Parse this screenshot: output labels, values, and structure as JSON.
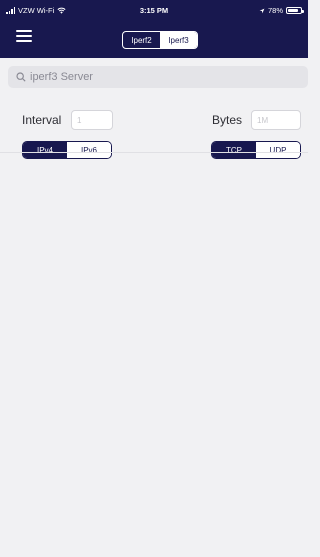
{
  "status_bar": {
    "carrier": "VZW Wi-Fi",
    "time": "3:15 PM",
    "battery": "78%"
  },
  "header": {
    "tabs": [
      {
        "label": "Iperf2",
        "selected": false
      },
      {
        "label": "Iperf3",
        "selected": true
      }
    ]
  },
  "search": {
    "placeholder": "iperf3 Server"
  },
  "options": {
    "interval_label": "Interval",
    "interval_placeholder": "1",
    "bytes_label": "Bytes",
    "bytes_placeholder": "1M",
    "ip_version": [
      {
        "label": "IPv4",
        "selected": true
      },
      {
        "label": "IPv6",
        "selected": false
      }
    ],
    "protocol": [
      {
        "label": "TCP",
        "selected": true
      },
      {
        "label": "UDP",
        "selected": false
      }
    ]
  },
  "colors": {
    "accent": "#18184f",
    "background": "#f1f1f3"
  }
}
